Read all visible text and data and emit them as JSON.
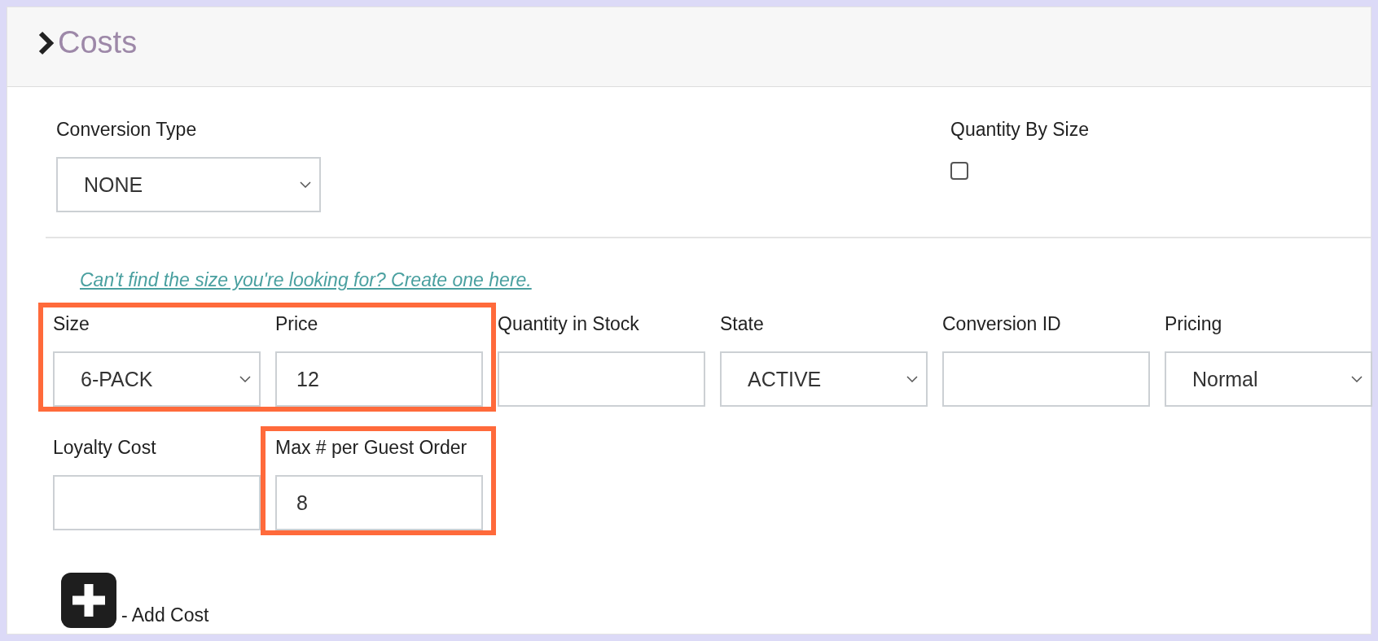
{
  "panel": {
    "title": "Costs"
  },
  "top_fields": [
    {
      "kind": "select",
      "label": "Conversion Type",
      "value": "NONE"
    },
    {
      "kind": "checkbox",
      "label": "Quantity By Size",
      "checked": false
    }
  ],
  "link": "Can't find the size you're looking for? Create one here.",
  "cost_rows": [
    [
      {
        "kind": "select",
        "label": "Size",
        "value": "6-PACK",
        "highlighted": true
      },
      {
        "kind": "text",
        "label": "Price",
        "value": "12",
        "highlighted": true
      },
      {
        "kind": "text",
        "label": "Quantity in Stock",
        "highlighted": false
      },
      {
        "kind": "select",
        "label": "State",
        "value": "ACTIVE",
        "highlighted": false
      },
      {
        "kind": "text",
        "label": "Conversion ID",
        "highlighted": false
      },
      {
        "kind": "select",
        "label": "Pricing",
        "value": "Normal",
        "highlighted": false
      }
    ],
    [
      {
        "kind": "text",
        "label": "Loyalty Cost",
        "highlighted": false
      },
      {
        "kind": "text",
        "label": "Max # per Guest Order",
        "value": "8",
        "highlighted": true
      }
    ]
  ],
  "add_button": {
    "label": "- Add Cost"
  }
}
